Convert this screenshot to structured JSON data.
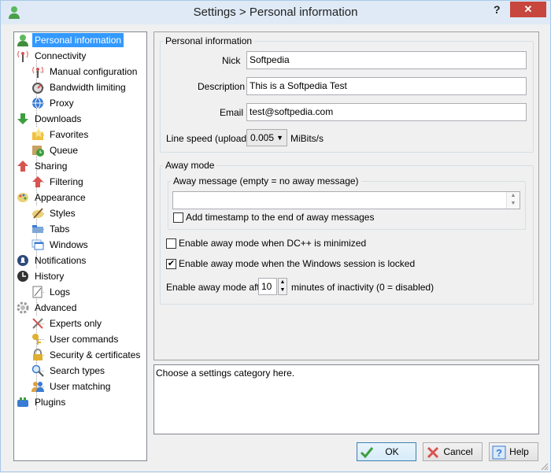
{
  "window": {
    "title": "Settings > Personal information",
    "help_glyph": "?",
    "close_glyph": "✕"
  },
  "tree": [
    {
      "label": "Personal information",
      "icon": "user-icon",
      "selected": true
    },
    {
      "label": "Connectivity",
      "icon": "antenna-icon"
    },
    {
      "label": "Manual configuration",
      "icon": "antenna-icon"
    },
    {
      "label": "Bandwidth limiting",
      "icon": "gauge-icon"
    },
    {
      "label": "Proxy",
      "icon": "globe-icon"
    },
    {
      "label": "Downloads",
      "icon": "down-arrow-icon"
    },
    {
      "label": "Favorites",
      "icon": "folder-star-icon"
    },
    {
      "label": "Queue",
      "icon": "queue-clock-icon"
    },
    {
      "label": "Sharing",
      "icon": "up-arrow-icon"
    },
    {
      "label": "Filtering",
      "icon": "up-arrow-icon"
    },
    {
      "label": "Appearance",
      "icon": "palette-icon"
    },
    {
      "label": "Styles",
      "icon": "brush-icon"
    },
    {
      "label": "Tabs",
      "icon": "tabs-icon"
    },
    {
      "label": "Windows",
      "icon": "windows-icon"
    },
    {
      "label": "Notifications",
      "icon": "bell-icon"
    },
    {
      "label": "History",
      "icon": "clock-icon"
    },
    {
      "label": "Logs",
      "icon": "log-icon"
    },
    {
      "label": "Advanced",
      "icon": "gear-icon"
    },
    {
      "label": "Experts only",
      "icon": "tools-icon"
    },
    {
      "label": "User commands",
      "icon": "key-icon"
    },
    {
      "label": "Security & certificates",
      "icon": "lock-icon"
    },
    {
      "label": "Search types",
      "icon": "magnifier-icon"
    },
    {
      "label": "User matching",
      "icon": "users-icon"
    },
    {
      "label": "Plugins",
      "icon": "plugin-icon"
    }
  ],
  "personal": {
    "group_title": "Personal information",
    "nick_label": "Nick",
    "nick_value": "Softpedia",
    "description_label": "Description",
    "description_value": "This is a Softpedia Test",
    "email_label": "Email",
    "email_value": "test@softpedia.com",
    "line_speed_label": "Line speed (upload)",
    "line_speed_value": "0.005",
    "line_speed_unit": "MiBits/s"
  },
  "away": {
    "group_title": "Away mode",
    "message_group_title": "Away message (empty = no away message)",
    "message_value": "",
    "timestamp_label": "Add timestamp to the end of away messages",
    "timestamp_checked": false,
    "minimized_label": "Enable away mode when DC++ is minimized",
    "minimized_checked": false,
    "locked_label": "Enable away mode when the Windows session is locked",
    "locked_checked": true,
    "after_label": "Enable away mode after",
    "after_value": "10",
    "after_suffix": "minutes of inactivity (0 = disabled)"
  },
  "info_text": "Choose a settings category here.",
  "buttons": {
    "ok": "OK",
    "cancel": "Cancel",
    "help": "Help"
  },
  "colors": {
    "selection": "#3399ff",
    "close": "#c7463d"
  }
}
